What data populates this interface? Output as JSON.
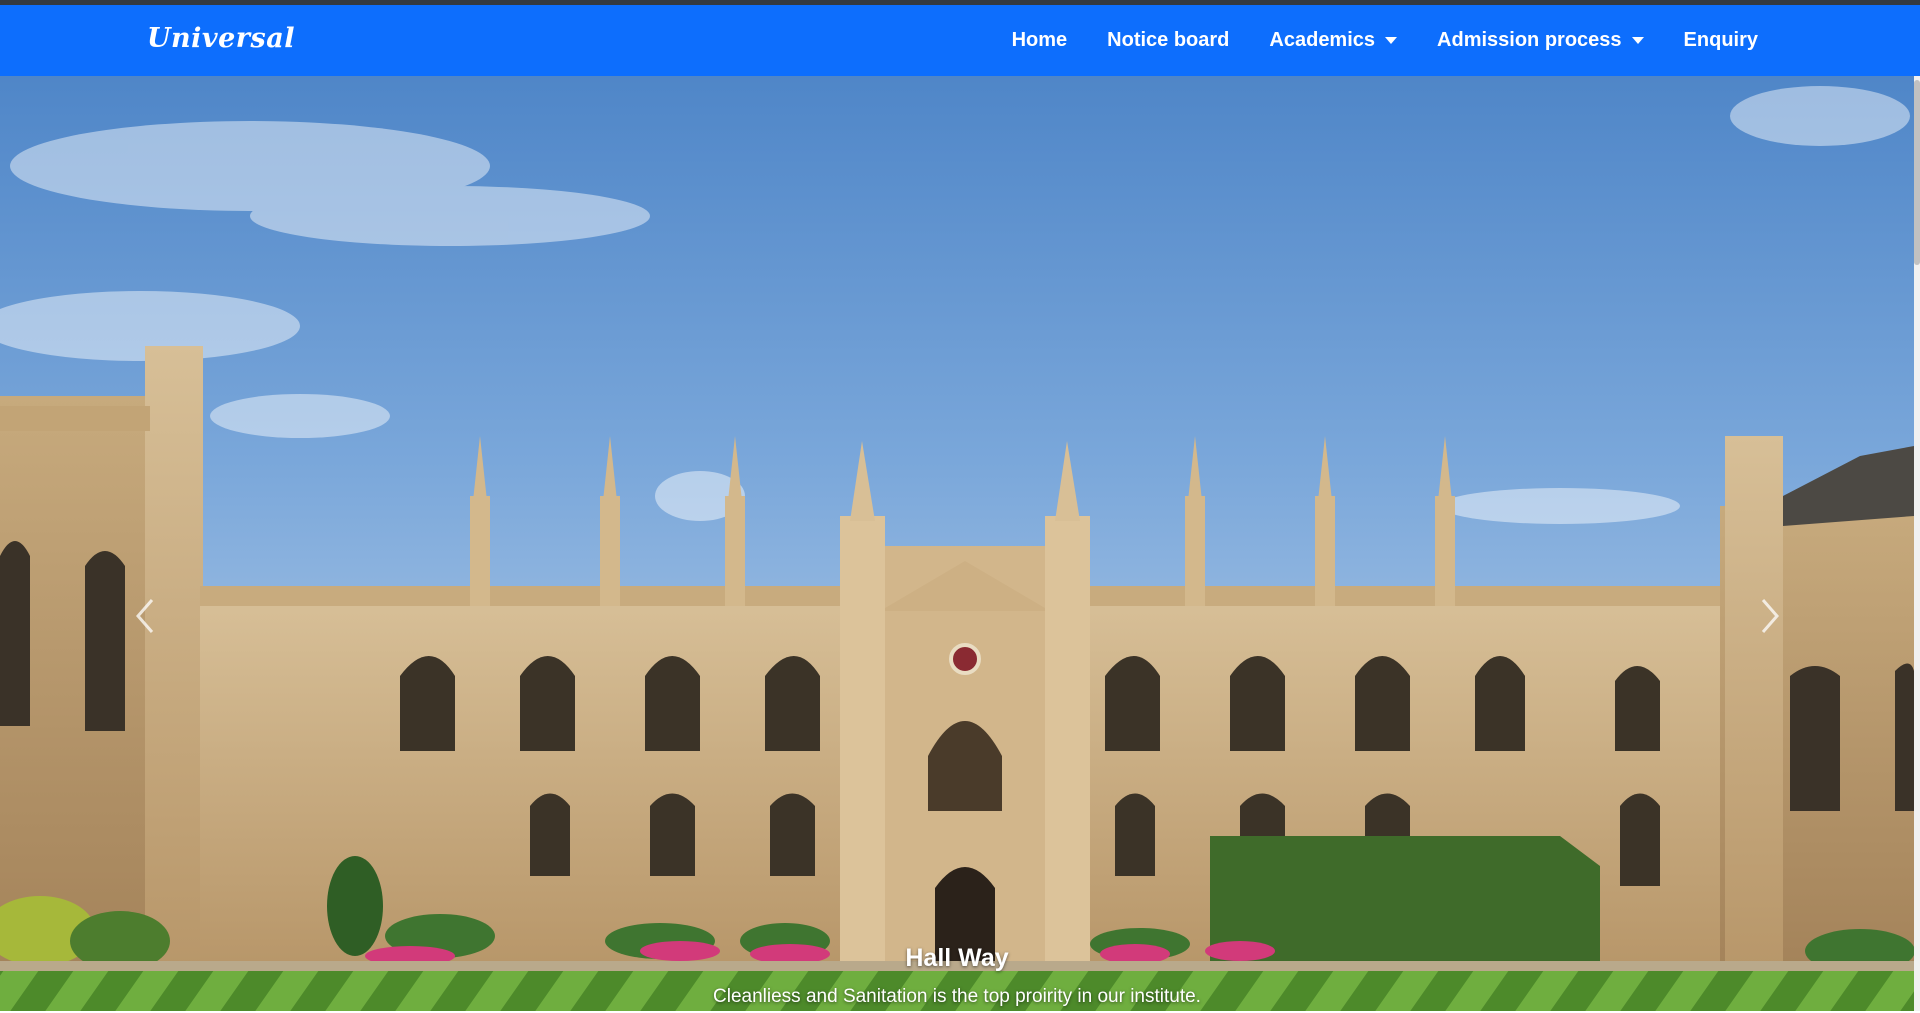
{
  "brand": {
    "name": "Universal"
  },
  "nav": {
    "home": "Home",
    "notice_board": "Notice board",
    "academics": "Academics",
    "admission_process": "Admission process",
    "enquiry": "Enquiry"
  },
  "carousel": {
    "slide_title": "Hall Way",
    "slide_text": "Cleanliess and Sanitation is the top proirity in our institute.",
    "prev_icon": "chevron-left-icon",
    "next_icon": "chevron-right-icon"
  },
  "colors": {
    "navbar": "#0d6efd",
    "sky": "#6f9fd6",
    "stone": "#c9ad82",
    "lawn_light": "#6fae3f",
    "lawn_dark": "#4d8a2a"
  }
}
